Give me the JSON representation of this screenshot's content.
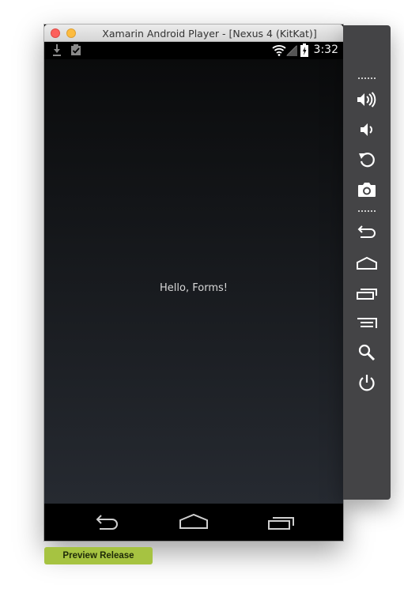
{
  "window": {
    "title": "Xamarin Android Player - [Nexus 4 (KitKat)]"
  },
  "status_bar": {
    "time": "3:32",
    "icons": [
      "download-icon",
      "clipboard-check-icon",
      "wifi-icon",
      "signal-icon",
      "battery-icon"
    ]
  },
  "screen": {
    "label_text": "Hello, Forms!",
    "gradient_top": "#0a0b0c",
    "gradient_bottom": "#262a31"
  },
  "nav_bar": {
    "buttons": [
      "back-icon",
      "home-icon",
      "recents-icon"
    ]
  },
  "side_panel": {
    "buttons": [
      "volume-up-icon",
      "volume-down-icon",
      "rotate-icon",
      "camera-icon",
      "back-icon",
      "home-icon",
      "recents-icon",
      "menu-icon",
      "search-icon",
      "power-icon"
    ]
  },
  "badge": {
    "label": "Preview Release",
    "color": "#a6c341"
  }
}
